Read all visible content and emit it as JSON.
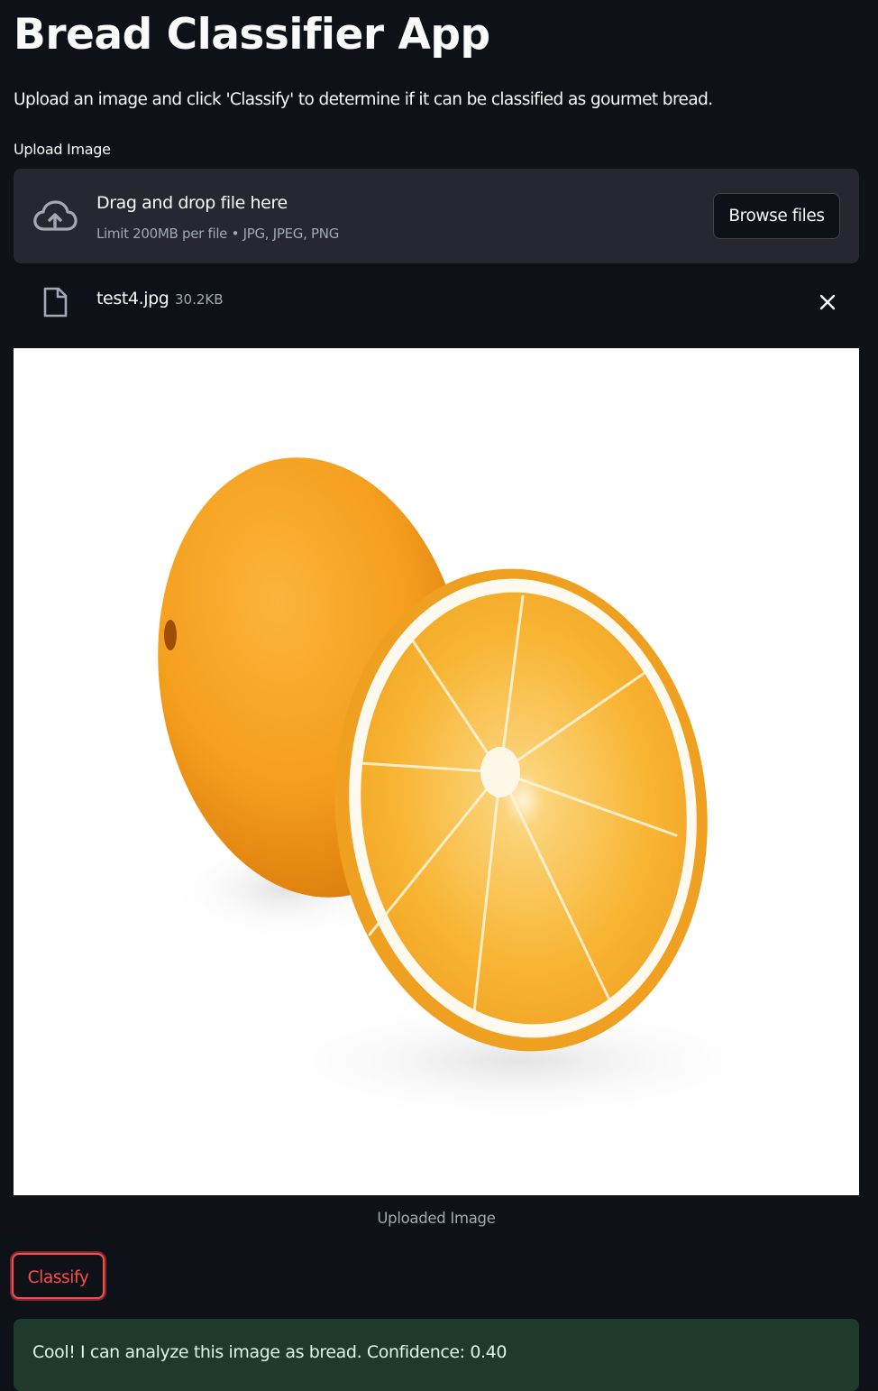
{
  "app": {
    "title": "Bread Classifier App",
    "description": "Upload an image and click 'Classify' to determine if it can be classified as gourmet bread."
  },
  "uploader": {
    "label": "Upload Image",
    "drop_title": "Drag and drop file here",
    "drop_limit": "Limit 200MB per file • JPG, JPEG, PNG",
    "browse_label": "Browse files",
    "icon": "cloud-upload-icon"
  },
  "file": {
    "name": "test4.jpg",
    "size": "30.2KB",
    "icon": "file-icon",
    "remove_icon": "close-icon"
  },
  "image": {
    "caption": "Uploaded Image",
    "alt": "photo of a whole orange and a halved orange"
  },
  "actions": {
    "classify_label": "Classify"
  },
  "result": {
    "text": "Cool! I can analyze this image as bread. Confidence: 0.40"
  },
  "colors": {
    "background": "#0e1117",
    "surface": "#262730",
    "accent": "#ff4b4b",
    "success_bg": "#1e3a2b",
    "muted_text": "#a3a8b4",
    "orange": "#f5a623"
  }
}
